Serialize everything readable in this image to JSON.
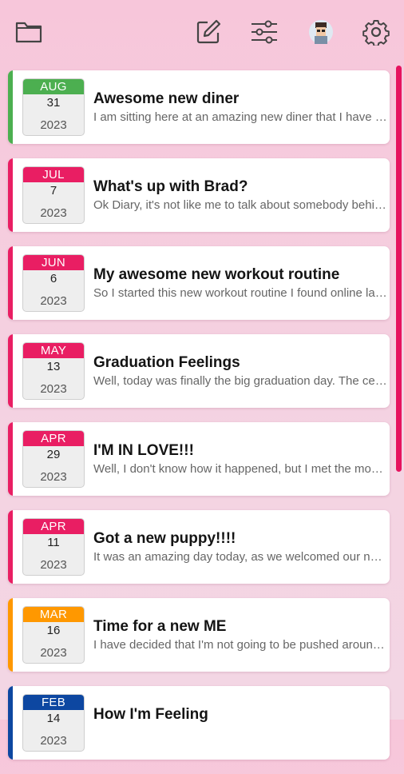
{
  "toolbar": {
    "icons": [
      "folder-icon",
      "compose-icon",
      "filter-sliders-icon",
      "avatar",
      "gear-icon"
    ]
  },
  "colors": {
    "green": "#4caf50",
    "pink": "#e91e63",
    "orange": "#ff9800",
    "blue": "#0d47a1",
    "scrollbar": "#e6135f"
  },
  "entries": [
    {
      "month": "AUG",
      "day": "31",
      "year": "2023",
      "title": "Awesome new diner",
      "preview": "I am sitting here at an amazing new diner that I have been wanting to try",
      "color": "#4caf50"
    },
    {
      "month": "JUL",
      "day": "7",
      "year": "2023",
      "title": "What's up with Brad?",
      "preview": "Ok Diary, it's not like me to talk about somebody behind their back but",
      "color": "#e91e63"
    },
    {
      "month": "JUN",
      "day": "6",
      "year": "2023",
      "title": "My awesome new workout routine",
      "preview": "So I started this new workout routine I found online last week and",
      "color": "#e91e63"
    },
    {
      "month": "MAY",
      "day": "13",
      "year": "2023",
      "title": "Graduation Feelings",
      "preview": "Well, today was finally the big graduation day. The ceremony was long",
      "color": "#e91e63"
    },
    {
      "month": "APR",
      "day": "29",
      "year": "2023",
      "title": "I'M IN LOVE!!!",
      "preview": "Well, I don't know how it happened, but I met the most amazing person",
      "color": "#e91e63"
    },
    {
      "month": "APR",
      "day": "11",
      "year": "2023",
      "title": "Got a new puppy!!!!",
      "preview": "It was an amazing day today, as we welcomed our new puppy home",
      "color": "#e91e63"
    },
    {
      "month": "MAR",
      "day": "16",
      "year": "2023",
      "title": "Time for a new ME",
      "preview": "I have decided that I'm not going to be pushed around anymore",
      "color": "#ff9800"
    },
    {
      "month": "FEB",
      "day": "14",
      "year": "2023",
      "title": "How I'm Feeling",
      "preview": "",
      "color": "#0d47a1"
    }
  ]
}
